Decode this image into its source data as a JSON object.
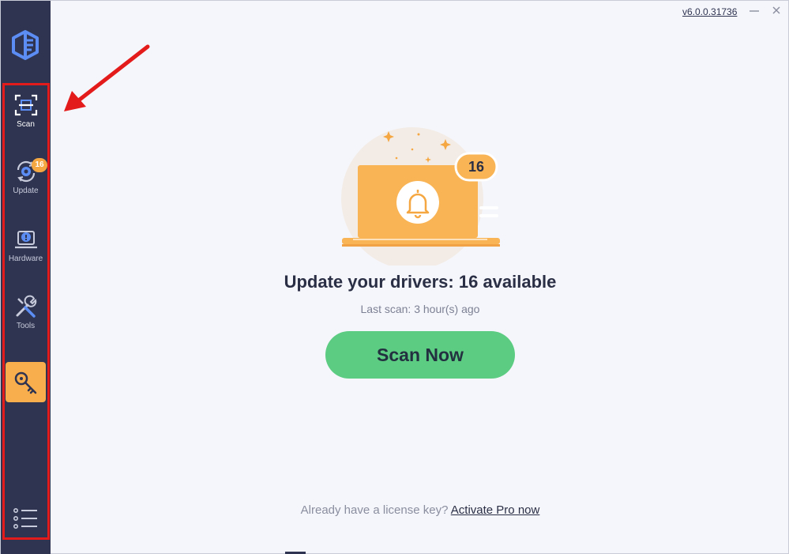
{
  "app": {
    "version": "v6.0.0.31736"
  },
  "sidebar": {
    "items": [
      {
        "label": "Scan",
        "icon": "scan-icon",
        "active": true
      },
      {
        "label": "Update",
        "icon": "update-icon",
        "badge": "16"
      },
      {
        "label": "Hardware",
        "icon": "hardware-icon"
      },
      {
        "label": "Tools",
        "icon": "tools-icon"
      }
    ],
    "key_icon": "key-icon",
    "menu_icon": "menu-list-icon"
  },
  "hero": {
    "badge_count": "16",
    "icon": "bell-icon"
  },
  "main": {
    "headline": "Update your drivers: 16 available",
    "last_scan": "Last scan: 3 hour(s) ago",
    "scan_button": "Scan Now",
    "license_prompt": "Already have a license key?",
    "activate_link": "Activate Pro now"
  },
  "colors": {
    "sidebar_bg": "#2f3450",
    "accent_orange": "#f8ae4d",
    "scan_button": "#5ccc82",
    "annotation_red": "#e41b1b",
    "content_bg": "#f5f6fb"
  }
}
